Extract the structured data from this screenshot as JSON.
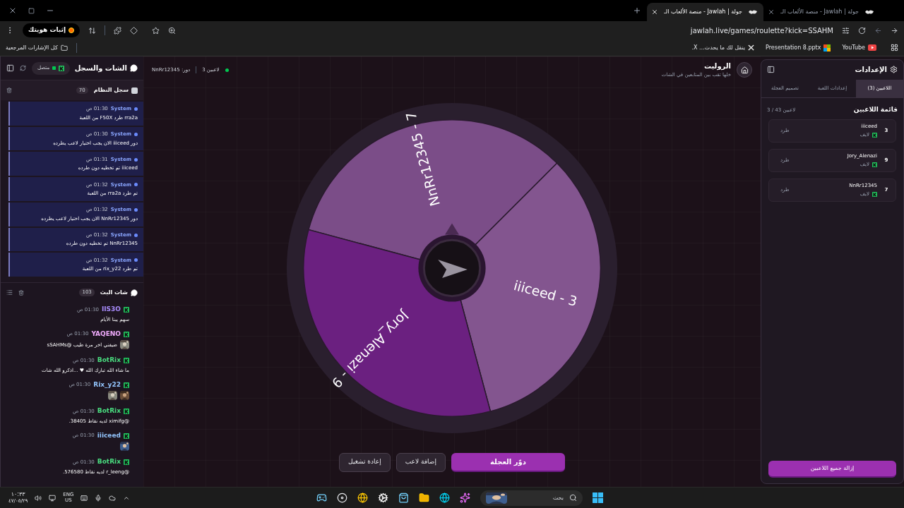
{
  "browser": {
    "tabs": [
      {
        "title": "جولة | Jawlah - منصة الألعاب الـ",
        "selected": false
      },
      {
        "title": "جولة | Jawlah - منصة الألعاب الـ",
        "selected": true
      }
    ],
    "url": "jawlah.live/games/roulette?kick=SSAHM",
    "profile": "إثبات هويتك",
    "bookmarks": [
      {
        "label": "YouTube",
        "kind": "video"
      },
      {
        "label": "Presentation 8.pptx",
        "kind": "document"
      },
      {
        "label": "ينقل لك ما يحدث... X.",
        "kind": "social"
      }
    ],
    "all_bookmarks": "كل الإشارات المرجعية"
  },
  "chat_panel": {
    "title": "الشات والسجل",
    "status": "متصل",
    "system_log": {
      "title": "سجل النظام",
      "count": "70",
      "entries": [
        {
          "sender": "System",
          "time": "01:30 ص",
          "text": "rra2a طرد F50X من اللعبة"
        },
        {
          "sender": "System",
          "time": "01:30 ص",
          "text": "دور iiiceed الان يجب اختيار لاعب يطرده"
        },
        {
          "sender": "System",
          "time": "01:31 ص",
          "text": "iiiceed تم تخطيه دون طرده"
        },
        {
          "sender": "System",
          "time": "01:32 ص",
          "text": "تم طرد rra2a من اللعبة"
        },
        {
          "sender": "System",
          "time": "01:32 ص",
          "text": "دور NnRr12345 الان يجب اختيار لاعب يطرده"
        },
        {
          "sender": "System",
          "time": "01:32 ص",
          "text": "NnRr12345 تم تخطيه دون طرده"
        },
        {
          "sender": "System",
          "time": "01:32 ص",
          "text": "تم طرد rix_y22 من اللعبة"
        }
      ]
    },
    "live_chat": {
      "title": "شات البث",
      "count": "103",
      "messages": [
        {
          "user": "IIS3O",
          "color": "#a78bfa",
          "time": "01:30 ص",
          "text": "سهم يبنا الأيام"
        },
        {
          "user": "YAQENO",
          "color": "#f0abfc",
          "time": "01:30 ص",
          "text": "ضيفني اخر مرة طيب @sSAHMs"
        },
        {
          "user": "BotRix",
          "color": "#4ade80",
          "time": "01:30 ص",
          "text": "ما شاء الله تبارك الله ♥ ...اذكرو الله شات"
        },
        {
          "user": "Rix_y22",
          "color": "#93c5fd",
          "time": "01:30 ص"
        },
        {
          "user": "BotRix",
          "color": "#4ade80",
          "time": "01:30 ص",
          "text": "@ximifg لديه نقاط 38405."
        },
        {
          "user": "iiiceed",
          "color": "#93c5fd",
          "time": "01:30 ص"
        },
        {
          "user": "BotRix",
          "color": "#4ade80",
          "time": "01:30 ص",
          "text": "@r_leeng لديه نقاط 576580."
        }
      ]
    }
  },
  "game": {
    "title": "الروليت",
    "subtitle": "خلها تقب بين المتابعين في الشات",
    "player_count": "3 لاعبين",
    "turn": "دور: NnRr12345",
    "wheel": {
      "segments": [
        {
          "label": "NnRr12345 - 7",
          "color": "#7b4d88"
        },
        {
          "label": "iiiceed - 3",
          "color": "#83558f"
        },
        {
          "label": "Jory_Alenazi - 9",
          "color": "#6b2080"
        }
      ]
    },
    "buttons": [
      {
        "label": "دوّر العجلة",
        "kind": "primary"
      },
      {
        "label": "إضافة لاعب",
        "kind": "secondary"
      },
      {
        "label": "إعادة تشغيل",
        "kind": "secondary"
      }
    ]
  },
  "settings": {
    "title": "الإعدادات",
    "tabs": [
      {
        "label": "اللاعبين (3)",
        "selected": true
      },
      {
        "label": "إعدادات اللعبة",
        "selected": false
      },
      {
        "label": "تصميم العجلة",
        "selected": false
      }
    ],
    "list_title": "قائمة اللاعبين",
    "list_count": "3 / 43 لاعبين",
    "players": [
      {
        "number": "3",
        "name": "iiiceed",
        "source": "لايف",
        "action": "طرد"
      },
      {
        "number": "9",
        "name": "Jory_Alenazi",
        "source": "لايف",
        "action": "طرد"
      },
      {
        "number": "7",
        "name": "NnRr12345",
        "source": "لايف",
        "action": "طرد"
      }
    ],
    "clear_button": "إزالة جميع اللاعبين"
  },
  "taskbar": {
    "time": "١٠:٣٣",
    "date": "٤٧/٠٥/٢٩",
    "language": "ENG",
    "region": "US",
    "search_placeholder": "بحث"
  }
}
